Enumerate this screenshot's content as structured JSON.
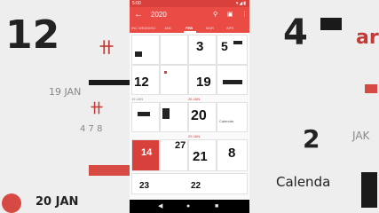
{
  "status_bar": {
    "time": "5:00",
    "system_icons": "signal-wifi-battery"
  },
  "toolbar": {
    "back_icon": "arrow-back-icon",
    "year": "2020",
    "icons": [
      "search-icon",
      "calendar-icon",
      "more-vert-icon"
    ]
  },
  "tabs": [
    {
      "label": "INC WEDDING",
      "active": false
    },
    {
      "label": "JAN",
      "active": false
    },
    {
      "label": "FEB",
      "active": true
    },
    {
      "label": "MAR",
      "active": false
    },
    {
      "label": "APR",
      "active": false
    }
  ],
  "calendar": {
    "day_numbers": [
      "3",
      "5",
      "12",
      "19",
      "20",
      "21",
      "23",
      "27",
      "14",
      "22"
    ],
    "date_labels": [
      "19 JAN",
      "26 JAN",
      "29 JAN"
    ],
    "events": [
      "Calendar"
    ]
  },
  "background": {
    "left_text": [
      "12",
      "19 JAN",
      "20 JAN"
    ],
    "right_text": [
      "ar",
      "JAK",
      "Calenda"
    ]
  },
  "nav": {
    "back": "◀",
    "home": "●",
    "recents": "■"
  },
  "colors": {
    "accent": "#ea4b45",
    "status": "#d8413b"
  }
}
